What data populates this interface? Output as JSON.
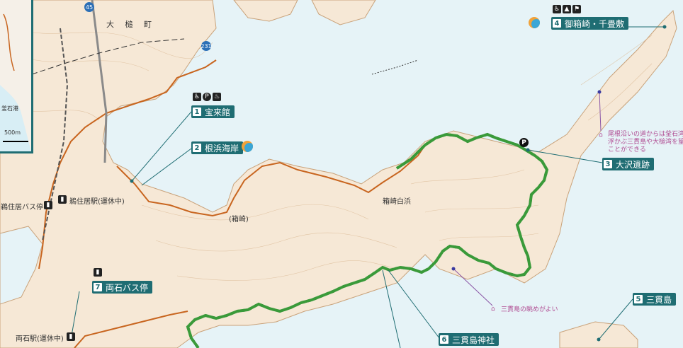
{
  "colors": {
    "sea": "#e6f3f7",
    "land": "#f6e8d6",
    "contour": "#d9b58f",
    "road": "#c8651f",
    "trail_green": "#3a9a3a",
    "trail_red": "#d43a2c",
    "label_bg": "#1f6d73",
    "pink": "#b04b92"
  },
  "place_names": {
    "town": "大 槌 町",
    "hakozaki": "(箱崎)",
    "hakozaki_shirahama": "箱崎白浜",
    "unosumai_station": "鵜住居駅(運休中)",
    "unosumai_bus": "鵜住居バス停",
    "ryoishi_station": "両石駅(運休中)",
    "kamaishi_port": "釜石港",
    "scale": "500m",
    "route_45": "45",
    "route_231": "231"
  },
  "spots": [
    {
      "num": "1",
      "label": "宝来館",
      "icons": [
        "トイレ",
        "P",
        "温泉"
      ]
    },
    {
      "num": "2",
      "label": "根浜海岸"
    },
    {
      "num": "3",
      "label": "大沢遺跡",
      "icons": [
        "P"
      ]
    },
    {
      "num": "4",
      "label": "御箱崎・千畳敷",
      "icons": [
        "トイレ",
        "キャンプ",
        "展望"
      ]
    },
    {
      "num": "5",
      "label": "三貫島"
    },
    {
      "num": "6",
      "label": "三貫島神社"
    },
    {
      "num": "7",
      "label": "両石バス停",
      "icons": [
        "バス"
      ]
    }
  ],
  "notes": {
    "ridge_view": [
      "尾根沿いの道からは釜石湾",
      "浮かぶ三貫島や大槌湾を望",
      "ことができる"
    ],
    "sankan_view": "三貫島の眺めがよい"
  }
}
